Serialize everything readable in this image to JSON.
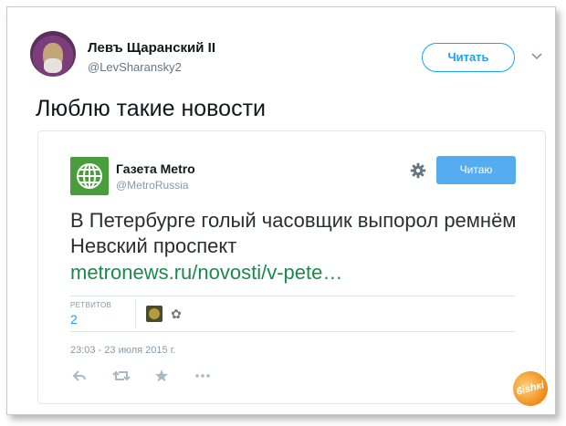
{
  "tweet": {
    "author_name": "Левъ Щаранский II",
    "author_handle": "@LevSharansky2",
    "follow_label": "Читать",
    "text": "Люблю такие новости"
  },
  "embedded_tweet": {
    "author_name": "Газета Metro",
    "author_handle": "@MetroRussia",
    "follow_label": "Читаю",
    "text": "В Петербурге голый часовщик выпорол ремнём Невский проспект",
    "link": "metronews.ru/novosti/v-pete…",
    "retweets_label": "РЕТВИТОВ",
    "retweets_count": "2",
    "timestamp": "23:03 - 23 июля 2015 г."
  },
  "icons": [
    "avatar",
    "globe-logo-icon",
    "gear-icon",
    "chevron-down-icon",
    "reply-icon",
    "retweet-icon",
    "like-icon",
    "more-icon"
  ],
  "colors": {
    "accent": "#1da1f2",
    "follow_filled": "#55acee",
    "link_green": "#1b8a4a",
    "metro_logo": "#4a9d3b"
  },
  "watermark": "Fishki"
}
